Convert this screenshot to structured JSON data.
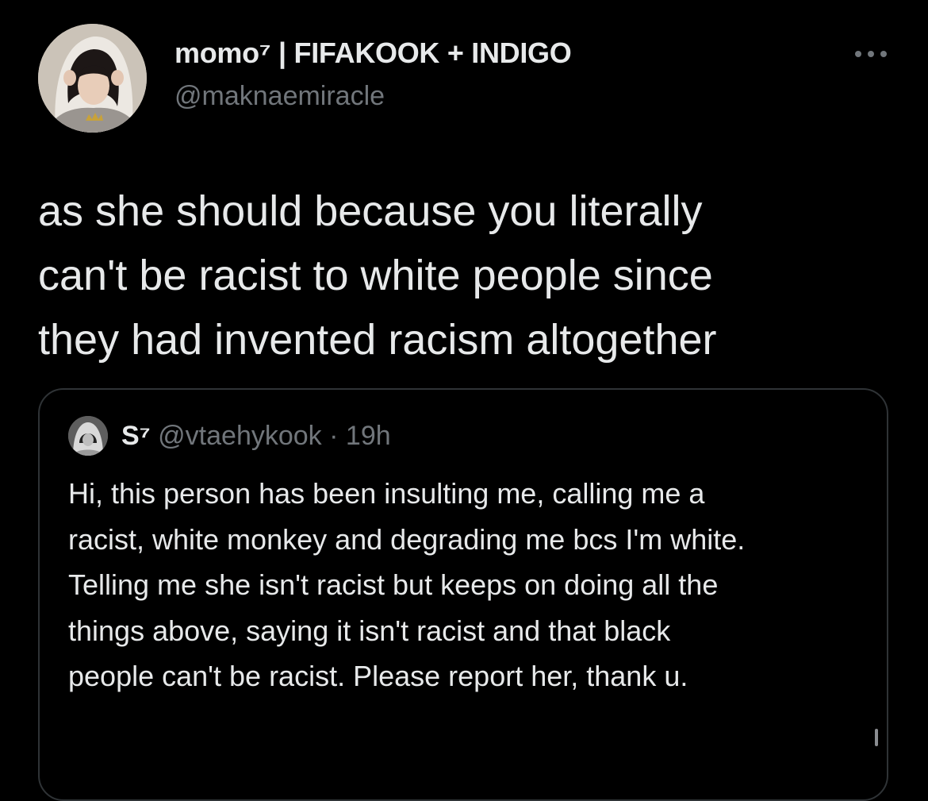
{
  "tweet": {
    "author": {
      "display_name": "momo⁷ | FIFAKOOK + INDIGO",
      "handle": "@maknaemiracle"
    },
    "lines": [
      "as she should because you literally",
      "can't be racist to white people since",
      "they had invented racism altogether"
    ],
    "menu_icon": "more-horizontal-icon"
  },
  "quoted_tweet": {
    "author": {
      "display_name": "S⁷",
      "handle": "@vtaehykook"
    },
    "separator": "·",
    "time": "19h",
    "lines": [
      "Hi, this person has been insulting me, calling me a",
      "racist, white monkey and degrading me bcs I'm white.",
      "Telling me she isn't racist but keeps on doing all the",
      "things above, saying it isn't racist and that black",
      "people can't be racist. Please report her, thank u."
    ]
  },
  "colors": {
    "background": "#000000",
    "primary_text": "#e7e9ea",
    "secondary_text": "#71767b",
    "border": "#2f3336"
  }
}
